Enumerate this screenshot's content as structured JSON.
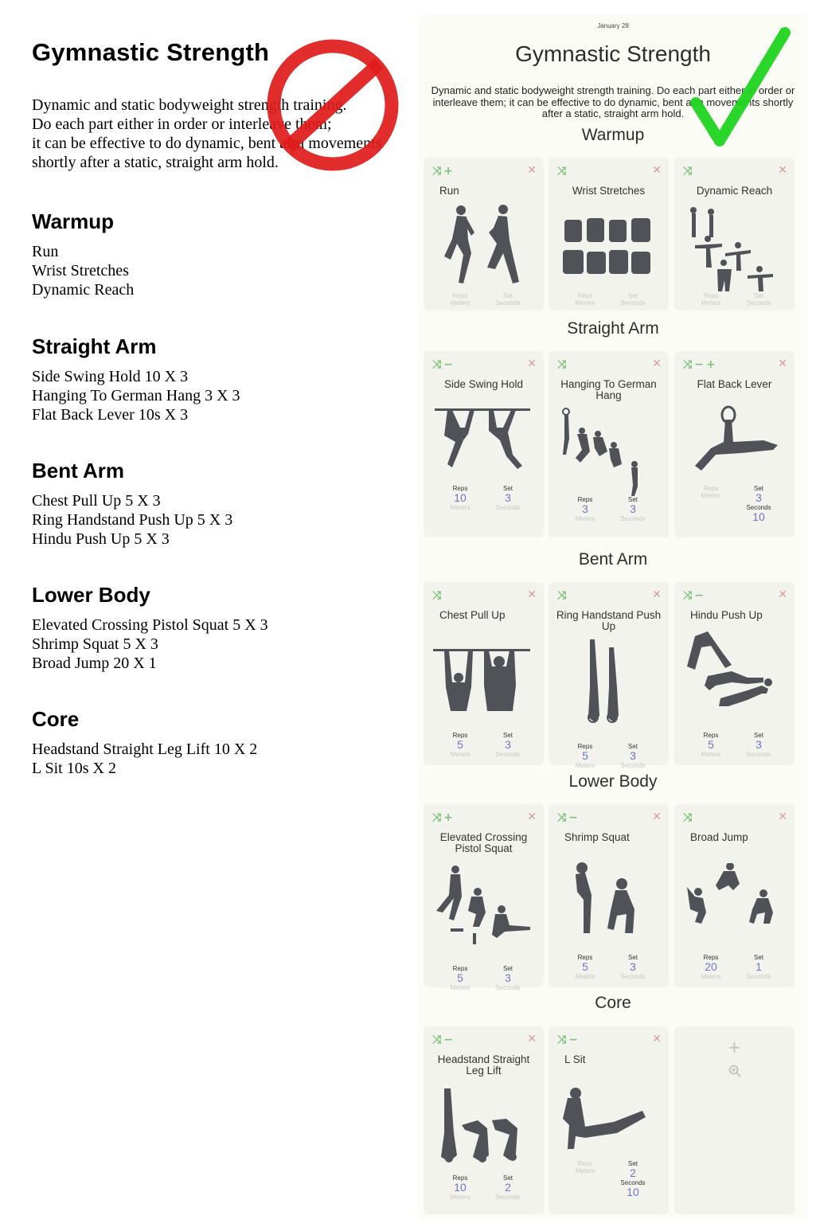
{
  "document": {
    "title": "Gymnastic Strength",
    "description_lines": [
      "Dynamic and static bodyweight strength training.",
      "Do each part either in order or interleave them;",
      "it can be effective to do dynamic, bent arm movements",
      "shortly after a static, straight arm hold."
    ],
    "sections": [
      {
        "heading": "Warmup",
        "lines": [
          "Run",
          "Wrist Stretches",
          "Dynamic Reach"
        ]
      },
      {
        "heading": "Straight Arm",
        "lines": [
          "Side Swing Hold 10 X 3",
          "Hanging To German Hang 3 X 3",
          "Flat Back Lever 10s X 3"
        ]
      },
      {
        "heading": "Bent Arm",
        "lines": [
          "Chest Pull Up 5 X 3",
          "Ring Handstand Push Up 5 X 3",
          "Hindu Push Up 5 X 3"
        ]
      },
      {
        "heading": "Lower Body",
        "lines": [
          "Elevated Crossing Pistol Squat 5 X 3",
          "Shrimp Squat 5 X 3",
          "Broad Jump 20 X 1"
        ]
      },
      {
        "heading": "Core",
        "lines": [
          "Headstand Straight Leg Lift 10 X 2",
          "L Sit 10s X 2"
        ]
      }
    ]
  },
  "overlay": {
    "left_mark": "prohibited-sign",
    "left_mark_color": "#e01b1b",
    "right_mark": "checkmark",
    "right_mark_color": "#1ed41e"
  },
  "app": {
    "date": "January 28",
    "title": "Gymnastic Strength",
    "description": "Dynamic and static bodyweight strength training. Do each part either in order or interleave them; it can be effective to do dynamic, bent arm movements shortly after a static, straight arm hold.",
    "labels": {
      "reps": "Reps",
      "meters": "Meters",
      "set": "Set",
      "seconds": "Seconds"
    },
    "icons": {
      "shuffle": "⤨",
      "plus": "+",
      "minus": "−",
      "close": "✕",
      "add": "+",
      "zoom": "zoom-in-icon"
    },
    "colors": {
      "accent_green": "#7ec27a",
      "close_red": "#d79a9e",
      "value_blue": "#6d75c9"
    },
    "sections": [
      {
        "title": "Warmup",
        "cards": [
          {
            "name": "Run",
            "controls": [
              "shuffle",
              "plus"
            ],
            "reps": "",
            "set": ""
          },
          {
            "name": "Wrist Stretches",
            "controls": [
              "shuffle"
            ],
            "reps": "",
            "set": ""
          },
          {
            "name": "Dynamic Reach",
            "controls": [
              "shuffle"
            ],
            "reps": "",
            "set": ""
          }
        ]
      },
      {
        "title": "Straight Arm",
        "cards": [
          {
            "name": "Side Swing Hold",
            "controls": [
              "shuffle",
              "minus"
            ],
            "reps": "10",
            "set": "3"
          },
          {
            "name": "Hanging To German Hang",
            "controls": [
              "shuffle"
            ],
            "reps": "3",
            "set": "3"
          },
          {
            "name": "Flat Back Lever",
            "controls": [
              "shuffle",
              "minus",
              "plus"
            ],
            "reps": "",
            "set": "3",
            "seconds": "10"
          }
        ]
      },
      {
        "title": "Bent Arm",
        "cards": [
          {
            "name": "Chest Pull Up",
            "controls": [
              "shuffle"
            ],
            "reps": "5",
            "set": "3"
          },
          {
            "name": "Ring Handstand Push Up",
            "controls": [
              "shuffle"
            ],
            "reps": "5",
            "set": "3"
          },
          {
            "name": "Hindu Push Up",
            "controls": [
              "shuffle",
              "minus"
            ],
            "reps": "5",
            "set": "3"
          }
        ]
      },
      {
        "title": "Lower Body",
        "cards": [
          {
            "name": "Elevated Crossing Pistol Squat",
            "controls": [
              "shuffle",
              "plus"
            ],
            "reps": "5",
            "set": "3"
          },
          {
            "name": "Shrimp Squat",
            "controls": [
              "shuffle",
              "minus"
            ],
            "reps": "5",
            "set": "3"
          },
          {
            "name": "Broad Jump",
            "controls": [
              "shuffle"
            ],
            "reps": "20",
            "set": "1"
          }
        ]
      },
      {
        "title": "Core",
        "cards": [
          {
            "name": "Headstand Straight Leg Lift",
            "controls": [
              "shuffle",
              "minus"
            ],
            "reps": "10",
            "set": "2"
          },
          {
            "name": "L Sit",
            "controls": [
              "shuffle",
              "minus"
            ],
            "reps": "",
            "set": "2",
            "seconds": "10"
          }
        ]
      }
    ]
  }
}
